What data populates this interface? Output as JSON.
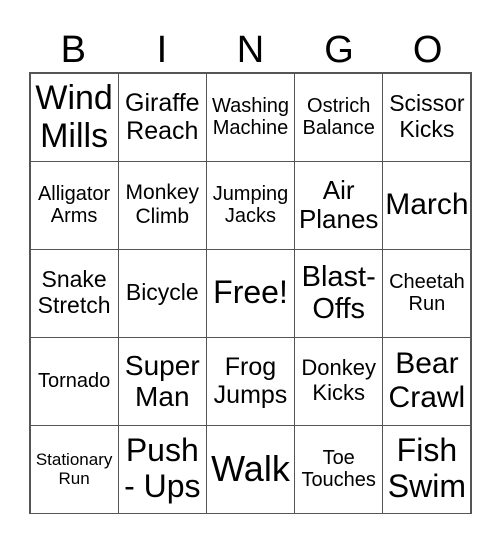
{
  "header": [
    "B",
    "I",
    "N",
    "G",
    "O"
  ],
  "cells": [
    {
      "text": "Wind\nMills",
      "size": 34
    },
    {
      "text": "Giraffe\nReach",
      "size": 25
    },
    {
      "text": "Washing\nMachine",
      "size": 20
    },
    {
      "text": "Ostrich\nBalance",
      "size": 20
    },
    {
      "text": "Scissor\nKicks",
      "size": 23
    },
    {
      "text": "Alligator\nArms",
      "size": 20
    },
    {
      "text": "Monkey\nClimb",
      "size": 21
    },
    {
      "text": "Jumping\nJacks",
      "size": 20
    },
    {
      "text": "Air\nPlanes",
      "size": 26
    },
    {
      "text": "March",
      "size": 30
    },
    {
      "text": "Snake\nStretch",
      "size": 23
    },
    {
      "text": "Bicycle",
      "size": 23
    },
    {
      "text": "Free!",
      "size": 32
    },
    {
      "text": "Blast-\nOffs",
      "size": 29
    },
    {
      "text": "Cheetah\nRun",
      "size": 20
    },
    {
      "text": "Tornado",
      "size": 20
    },
    {
      "text": "Super\nMan",
      "size": 28
    },
    {
      "text": "Frog\nJumps",
      "size": 25
    },
    {
      "text": "Donkey\nKicks",
      "size": 22
    },
    {
      "text": "Bear\nCrawl",
      "size": 30
    },
    {
      "text": "Stationary\nRun",
      "size": 17
    },
    {
      "text": "Push\n- Ups",
      "size": 32
    },
    {
      "text": "Walk",
      "size": 36
    },
    {
      "text": "Toe\nTouches",
      "size": 20
    },
    {
      "text": "Fish\nSwim",
      "size": 32
    }
  ]
}
